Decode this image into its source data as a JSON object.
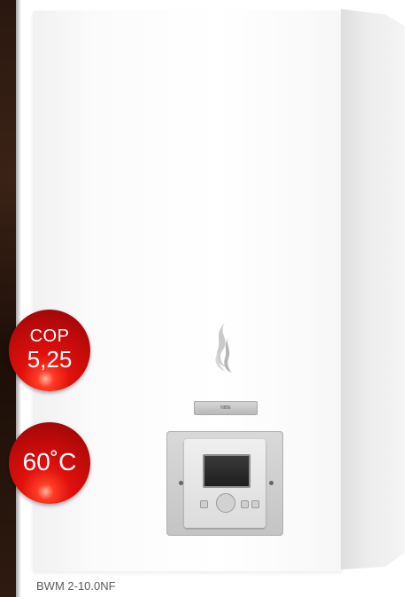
{
  "badges": {
    "cop": {
      "label": "COP",
      "value": "5,25"
    },
    "temperature": {
      "value": "60˚C"
    }
  },
  "product": {
    "model": "BWM 2-10.0NF",
    "brand_plate": "NIBE"
  },
  "colors": {
    "badge_red": "#d90f0c",
    "unit_white": "#ffffff",
    "panel_grey": "#c4c4c4",
    "background_dark": "#2a1810"
  },
  "icons": [
    "flame-logo-icon"
  ]
}
